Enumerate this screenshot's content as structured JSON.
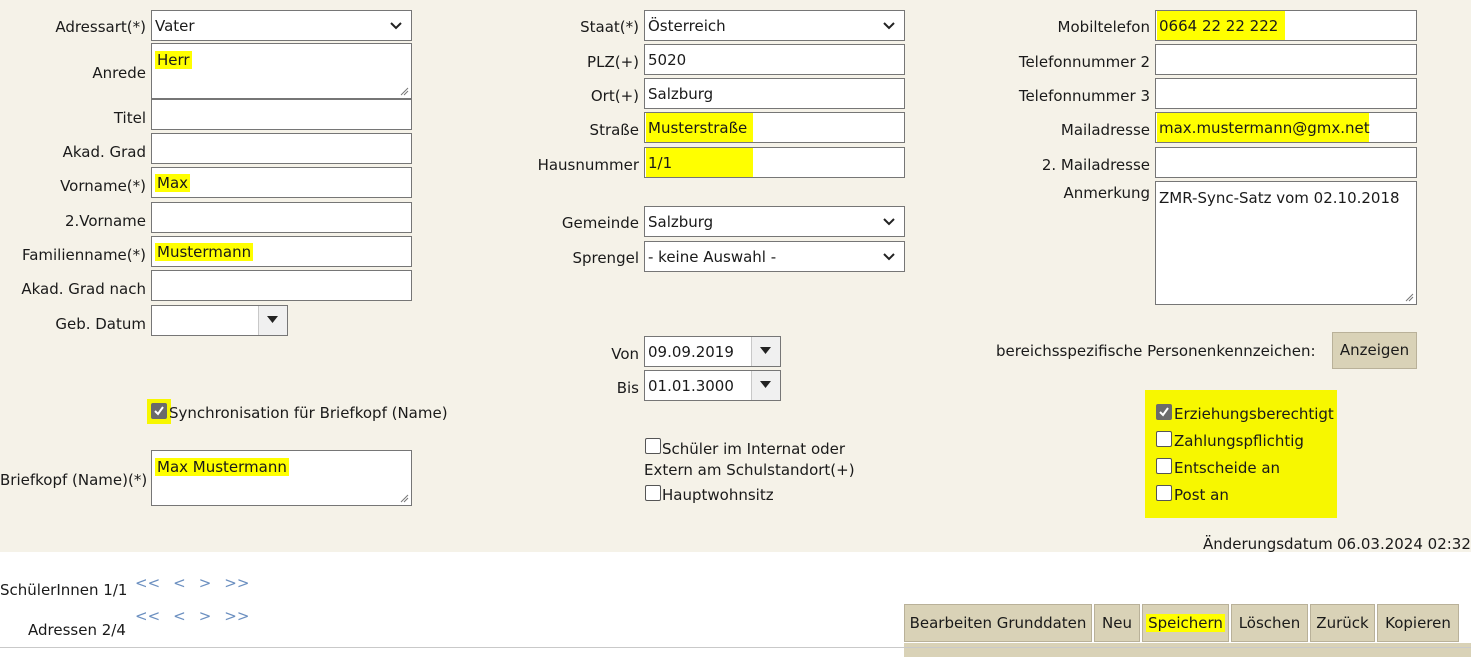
{
  "col1": {
    "labels": {
      "adressart": "Adressart(*)",
      "anrede": "Anrede",
      "titel": "Titel",
      "akad_grad": "Akad. Grad",
      "vorname": "Vorname(*)",
      "vorname2": "2.Vorname",
      "familienname": "Familienname(*)",
      "akad_grad_nach": "Akad. Grad nach",
      "geb_datum": "Geb. Datum",
      "briefkopf": "Briefkopf (Name)(*)"
    },
    "values": {
      "adressart": "Vater",
      "anrede": "Herr",
      "titel": "",
      "akad_grad": "",
      "vorname": "Max",
      "vorname2": "",
      "familienname": "Mustermann",
      "akad_grad_nach": "",
      "geb_datum": "",
      "briefkopf": "Max Mustermann"
    },
    "sync_checkbox": {
      "label": "Synchronisation für Briefkopf (Name)",
      "checked": true
    }
  },
  "col2": {
    "labels": {
      "staat": "Staat(*)",
      "plz": "PLZ(+)",
      "ort": "Ort(+)",
      "strasse": "Straße",
      "hausnummer": "Hausnummer",
      "gemeinde": "Gemeinde",
      "sprengel": "Sprengel",
      "von": "Von",
      "bis": "Bis"
    },
    "values": {
      "staat": "Österreich",
      "plz": "5020",
      "ort": "Salzburg",
      "strasse": "Musterstraße",
      "hausnummer": "1/1",
      "gemeinde": "Salzburg",
      "sprengel": "- keine Auswahl -",
      "von": "09.09.2019",
      "bis": "01.01.3000"
    },
    "internat_checkbox": {
      "label_line1": "Schüler im Internat oder",
      "label_line2": "Extern am Schulstandort(+)",
      "checked": false
    },
    "hauptwohnsitz_checkbox": {
      "label": "Hauptwohnsitz",
      "checked": false
    }
  },
  "col3": {
    "labels": {
      "mobiltelefon": "Mobiltelefon",
      "telefon2": "Telefonnummer 2",
      "telefon3": "Telefonnummer 3",
      "mailadresse": "Mailadresse",
      "mailadresse2": "2. Mailadresse",
      "anmerkung": "Anmerkung"
    },
    "values": {
      "mobiltelefon": "0664 22 22 222",
      "telefon2": "",
      "telefon3": "",
      "mailadresse": "max.mustermann@gmx.net",
      "mailadresse2": "",
      "anmerkung": "ZMR-Sync-Satz vom 02.10.2018"
    },
    "bpk_label": "bereichsspezifische Personenkennzeichen:",
    "anzeigen_button": "Anzeigen",
    "flags": [
      {
        "label": "Erziehungsberechtigt",
        "checked": true
      },
      {
        "label": "Zahlungspflichtig",
        "checked": false
      },
      {
        "label": "Entscheide an",
        "checked": false
      },
      {
        "label": "Post an",
        "checked": false
      }
    ],
    "aenderungsdatum_label": "Änderungsdatum",
    "aenderungsdatum_value": "06.03.2024 02:32"
  },
  "navigation": {
    "schueler_label": "SchülerInnen 1/1",
    "adressen_label": "Adressen 2/4",
    "first": "<<",
    "prev": "<",
    "next": ">",
    "last": ">>"
  },
  "toolbar": {
    "bearbeiten": "Bearbeiten Grunddaten",
    "neu": "Neu",
    "speichern": "Speichern",
    "loeschen": "Löschen",
    "zurueck": "Zurück",
    "kopieren": "Kopieren"
  },
  "colors": {
    "highlight": "#ffff00",
    "form_bg": "#f5f2e8",
    "button_bg": "#d9d2b7",
    "nav_arrow": "#6b8fc0"
  }
}
